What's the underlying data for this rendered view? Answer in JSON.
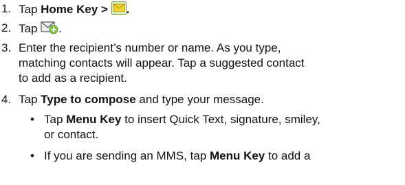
{
  "steps": [
    {
      "num": "1.",
      "pre": "Tap ",
      "bold": "Home Key >",
      "post": "."
    },
    {
      "num": "2.",
      "pre": "Tap ",
      "post": "."
    },
    {
      "num": "3.",
      "line1": "Enter the recipient’s number or name. As you type,",
      "line2": "matching contacts will appear. Tap a suggested contact",
      "line3": "to add as a recipient."
    },
    {
      "num": "4.",
      "pre": "Tap ",
      "bold": "Type to compose",
      "post": " and type your message."
    }
  ],
  "bullets": [
    {
      "dot": "•",
      "pre": "Tap ",
      "bold": "Menu Key",
      "post": " to insert Quick Text, signature, smiley,",
      "line2": "or contact."
    },
    {
      "dot": "•",
      "pre": "If you are sending an MMS, tap ",
      "bold": "Menu Key",
      "post": " to add a"
    }
  ],
  "icons": {
    "step1": "messaging-envelope-icon",
    "step2": "new-message-icon"
  },
  "colors": {
    "text": "#111111",
    "icon_yellow": "#f2d32b",
    "icon_green": "#7cc142"
  }
}
